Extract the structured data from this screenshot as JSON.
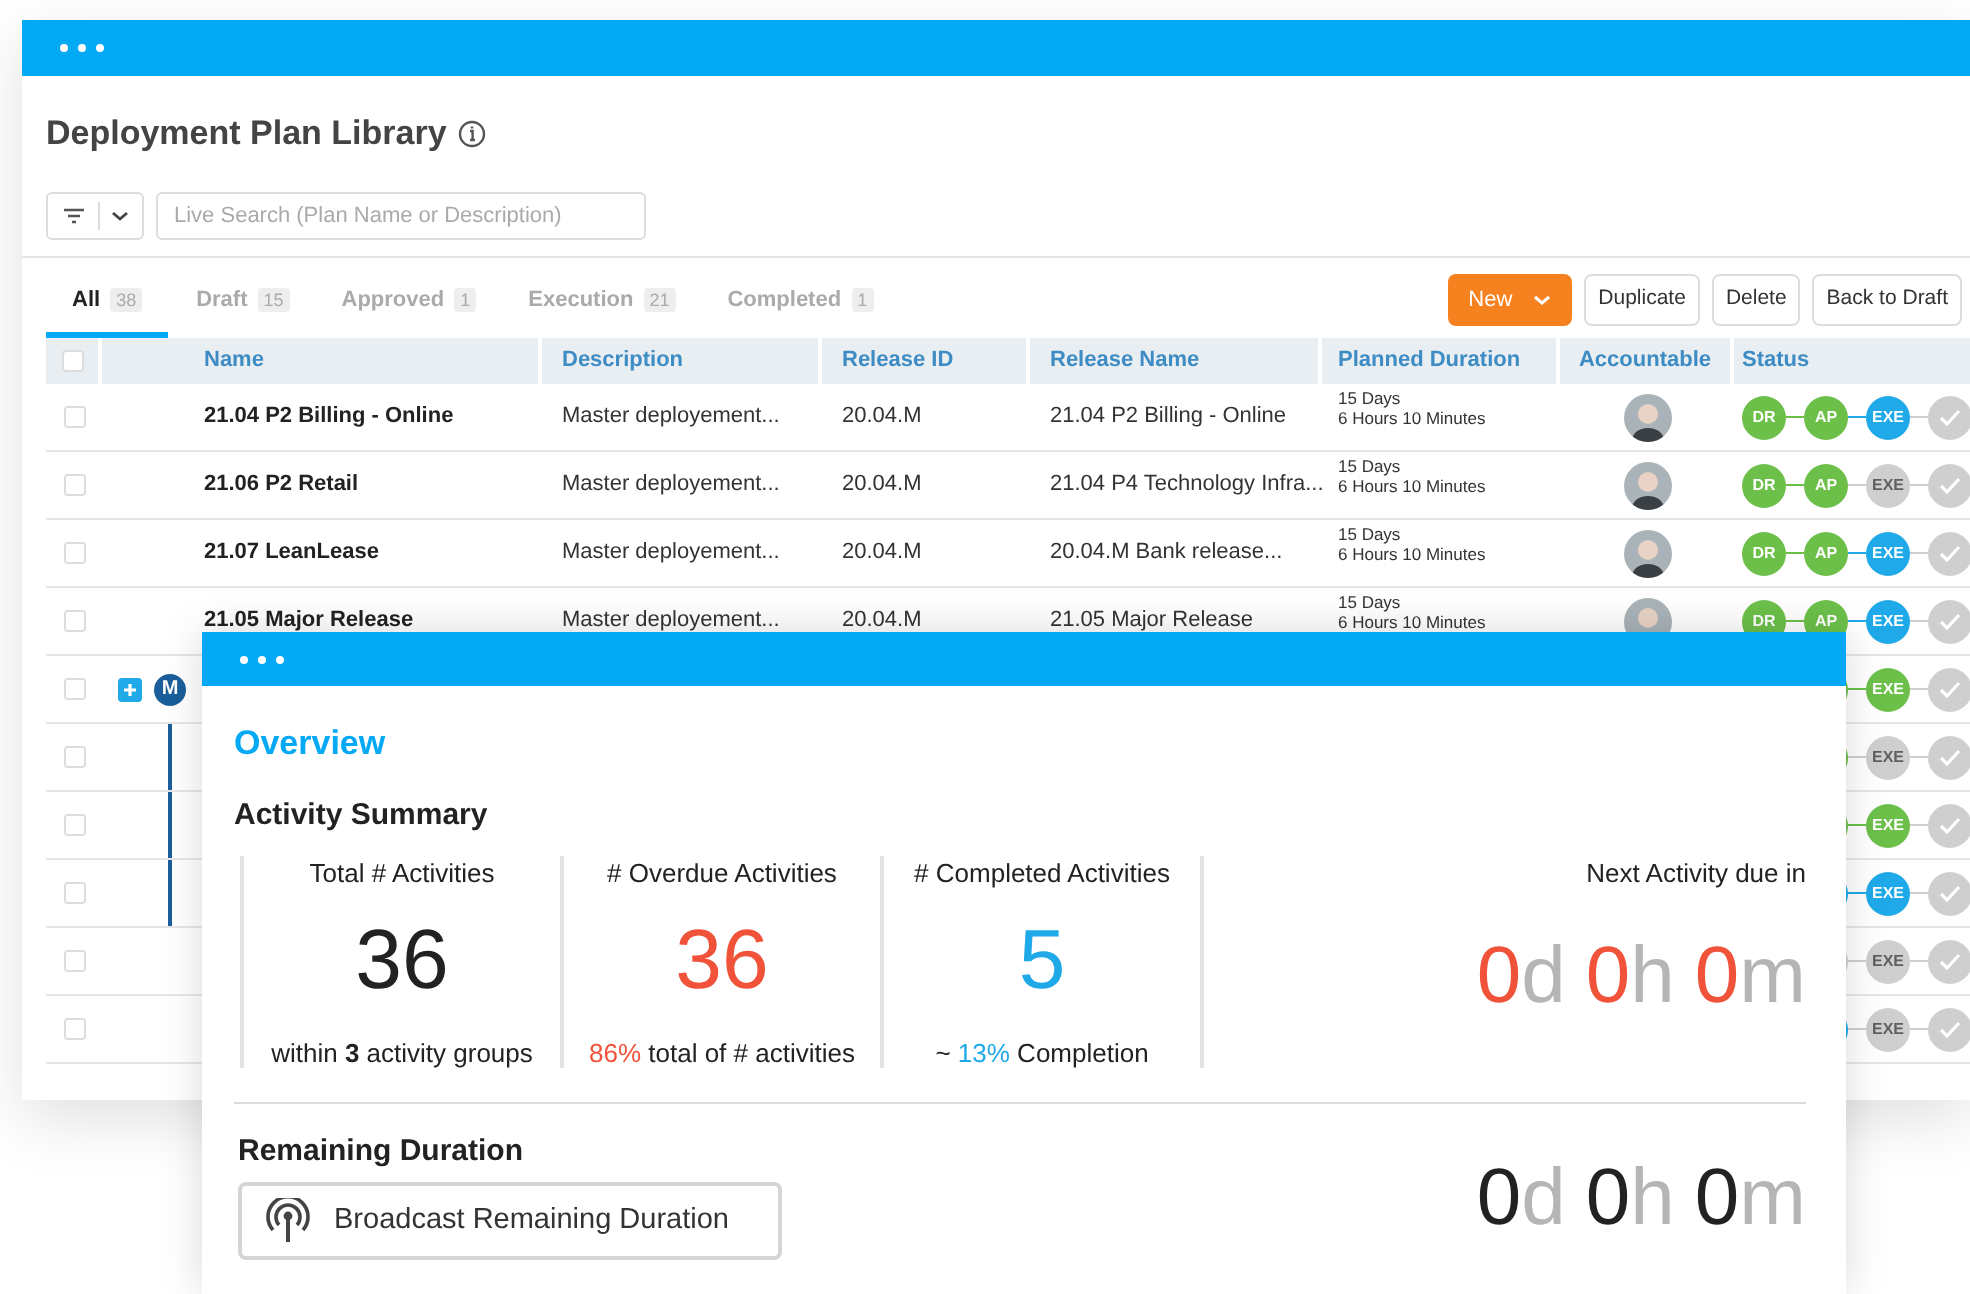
{
  "library": {
    "title": "Deployment Plan Library",
    "search": {
      "placeholder": "Live Search (Plan Name or Description)"
    },
    "tabs": [
      {
        "label": "All",
        "count": "38",
        "selected": true
      },
      {
        "label": "Draft",
        "count": "15",
        "selected": false
      },
      {
        "label": "Approved",
        "count": "1",
        "selected": false
      },
      {
        "label": "Execution",
        "count": "21",
        "selected": false
      },
      {
        "label": "Completed",
        "count": "1",
        "selected": false
      }
    ],
    "actions": [
      {
        "label": "New",
        "kind": "primary"
      },
      {
        "label": "Duplicate",
        "kind": "plain"
      },
      {
        "label": "Delete",
        "kind": "plain"
      },
      {
        "label": "Back to Draft",
        "kind": "plain"
      }
    ],
    "table": {
      "select_all_checked": false,
      "columns": [
        "Name",
        "Description",
        "Release ID",
        "Release Name",
        "Planned Duration",
        "Accountable",
        "Status"
      ],
      "rows": [
        {
          "kind": "plan",
          "checked": false,
          "name": "21.04 P2 Billing - Online",
          "description": "Master deployement...",
          "release_id": "20.04.M",
          "release_name": "21.04 P2 Billing - Online",
          "duration": [
            "15 Days",
            "6 Hours 10 Minutes"
          ],
          "avatar": true,
          "status": [
            {
              "kind": "stage",
              "label": "DR",
              "done": true,
              "current": false
            },
            {
              "kind": "stage",
              "label": "AP",
              "done": true,
              "current": false
            },
            {
              "kind": "stage",
              "label": "EXE",
              "done": false,
              "current": true
            },
            {
              "kind": "check",
              "done": false,
              "current": false
            }
          ]
        },
        {
          "kind": "plan",
          "checked": false,
          "name": "21.06 P2 Retail",
          "description": "Master deployement...",
          "release_id": "20.04.M",
          "release_name": "21.04 P4 Technology Infra...",
          "duration": [
            "15 Days",
            "6 Hours 10 Minutes"
          ],
          "avatar": true,
          "status": [
            {
              "kind": "stage",
              "label": "DR",
              "done": true,
              "current": false
            },
            {
              "kind": "stage",
              "label": "AP",
              "done": true,
              "current": false
            },
            {
              "kind": "stage",
              "label": "EXE",
              "done": false,
              "current": false
            },
            {
              "kind": "check",
              "done": false,
              "current": false
            }
          ]
        },
        {
          "kind": "plan",
          "checked": false,
          "name": "21.07 LeanLease",
          "description": "Master deployement...",
          "release_id": "20.04.M",
          "release_name": "20.04.M Bank release...",
          "duration": [
            "15 Days",
            "6 Hours 10 Minutes"
          ],
          "avatar": true,
          "status": [
            {
              "kind": "stage",
              "label": "DR",
              "done": true,
              "current": false
            },
            {
              "kind": "stage",
              "label": "AP",
              "done": true,
              "current": false
            },
            {
              "kind": "stage",
              "label": "EXE",
              "done": false,
              "current": true
            },
            {
              "kind": "check",
              "done": false,
              "current": false
            }
          ]
        },
        {
          "kind": "plan",
          "checked": false,
          "name": "21.05 Major Release",
          "description": "Master deployement...",
          "release_id": "20.04.M",
          "release_name": "21.05 Major Release",
          "duration": [
            "15 Days",
            "6 Hours 10 Minutes"
          ],
          "avatar": true,
          "status": [
            {
              "kind": "stage",
              "label": "DR",
              "done": true,
              "current": false
            },
            {
              "kind": "stage",
              "label": "AP",
              "done": true,
              "current": false
            },
            {
              "kind": "stage",
              "label": "EXE",
              "done": false,
              "current": true
            },
            {
              "kind": "check",
              "done": false,
              "current": false
            }
          ]
        },
        {
          "kind": "group",
          "checked": false,
          "badge": "M",
          "expanded": false,
          "status": [
            {
              "kind": "stage",
              "done": true,
              "current": false
            },
            {
              "kind": "stage",
              "label": "EXE",
              "done": true,
              "current": false
            },
            {
              "kind": "check",
              "done": false,
              "current": false
            }
          ],
          "children": [
            {
              "kind": "plan",
              "checked": false,
              "status": [
                {
                  "kind": "stage",
                  "done": true,
                  "current": false
                },
                {
                  "kind": "stage",
                  "label": "EXE",
                  "done": false,
                  "current": false
                },
                {
                  "kind": "check",
                  "done": false,
                  "current": false
                }
              ]
            },
            {
              "kind": "plan",
              "checked": false,
              "status": [
                {
                  "kind": "stage",
                  "done": true,
                  "current": false
                },
                {
                  "kind": "stage",
                  "label": "EXE",
                  "done": true,
                  "current": false
                },
                {
                  "kind": "check",
                  "done": false,
                  "current": false
                }
              ]
            },
            {
              "kind": "plan",
              "checked": false,
              "status": [
                {
                  "kind": "stage",
                  "done": false,
                  "current": true
                },
                {
                  "kind": "stage",
                  "label": "EXE",
                  "done": false,
                  "current": true
                },
                {
                  "kind": "check",
                  "done": false,
                  "current": false
                }
              ]
            }
          ]
        },
        {
          "kind": "plan",
          "checked": false,
          "status": [
            {
              "kind": "stage",
              "done": false,
              "current": false
            },
            {
              "kind": "stage",
              "label": "EXE",
              "done": false,
              "current": false
            },
            {
              "kind": "check",
              "done": false,
              "current": false
            }
          ]
        },
        {
          "kind": "plan",
          "checked": false,
          "status": [
            {
              "kind": "stage",
              "done": false,
              "current": true
            },
            {
              "kind": "stage",
              "label": "EXE",
              "done": false,
              "current": false
            },
            {
              "kind": "check",
              "done": false,
              "current": false
            }
          ]
        }
      ]
    }
  },
  "overview": {
    "title": "Overview",
    "summary_title": "Activity Summary",
    "stats": [
      {
        "label": "Total # Activities",
        "value": "36",
        "color": "#222222",
        "note": [
          {
            "text": "within **3** activity groups",
            "highlight": false
          }
        ]
      },
      {
        "label": "# Overdue Activities",
        "value": "36",
        "color": "#f0533a",
        "note": [
          {
            "text": "86%",
            "highlight": true
          },
          {
            "text": " total of # activities",
            "highlight": false
          }
        ]
      },
      {
        "label": "# Completed Activities",
        "value": "5",
        "color": "#1fa9e8",
        "note": [
          {
            "text": "~ ",
            "highlight": false
          },
          {
            "text": "13%",
            "highlight": true
          },
          {
            "text": " Completion",
            "highlight": false
          }
        ]
      }
    ],
    "next_due": {
      "label": "Next Activity due in",
      "alert": true,
      "parts": [
        {
          "value": "0",
          "unit": "d"
        },
        {
          "value": "0",
          "unit": "h"
        },
        {
          "value": "0",
          "unit": "m"
        }
      ]
    },
    "remaining": {
      "title": "Remaining Duration",
      "button": "Broadcast Remaining Duration",
      "alert": false,
      "parts": [
        {
          "value": "0",
          "unit": "d"
        },
        {
          "value": "0",
          "unit": "h"
        },
        {
          "value": "0",
          "unit": "m"
        }
      ]
    }
  }
}
